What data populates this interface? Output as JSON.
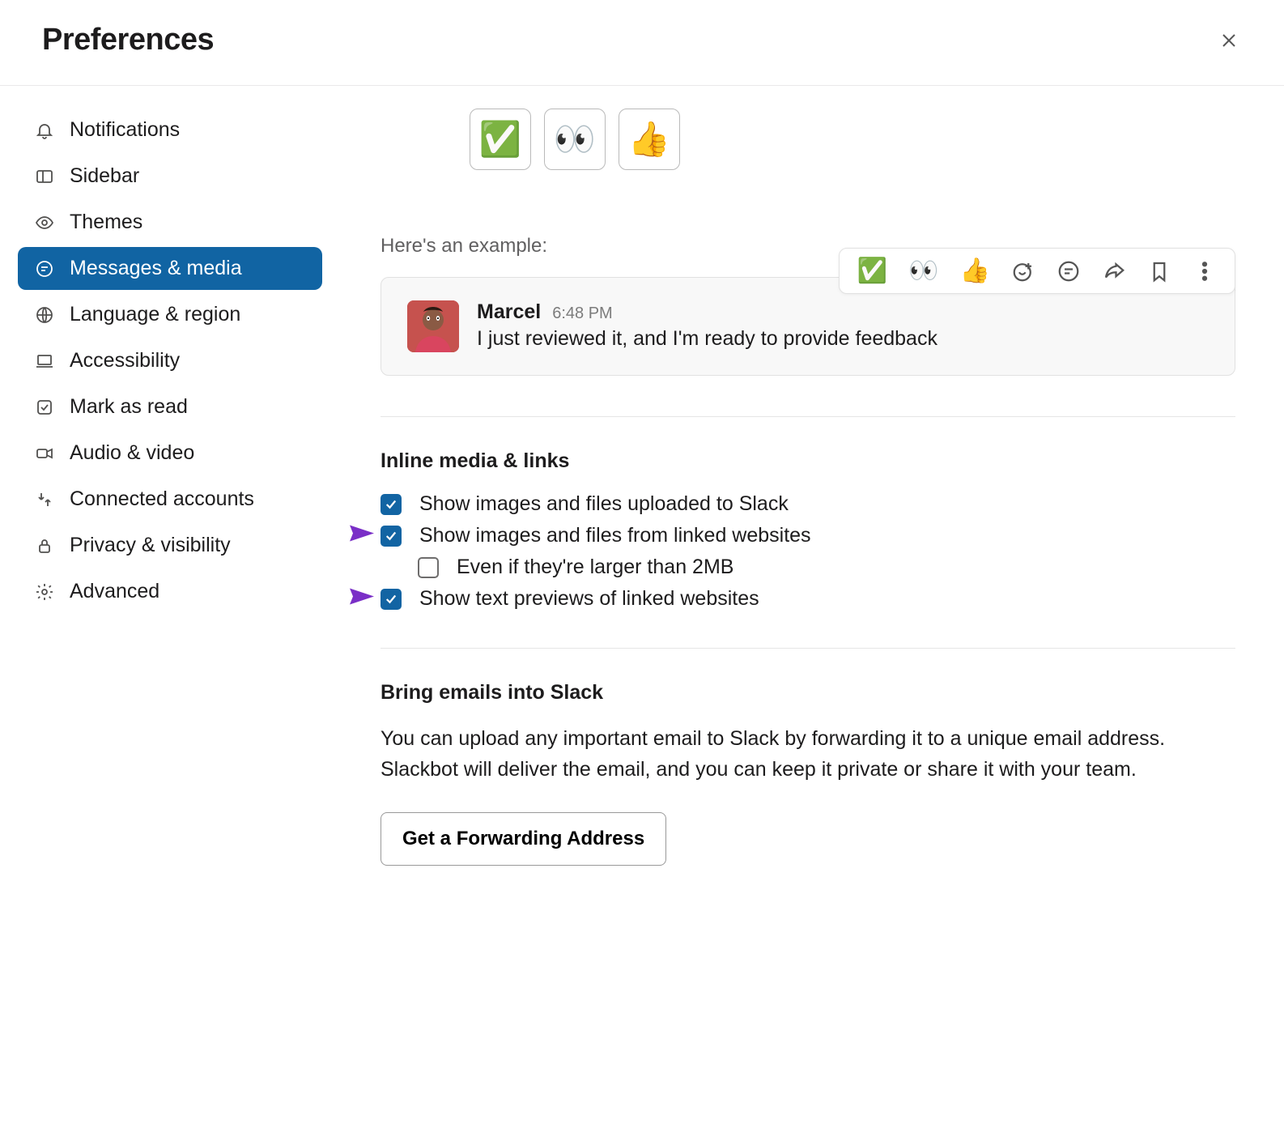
{
  "header": {
    "title": "Preferences"
  },
  "sidebar": {
    "items": [
      {
        "label": "Notifications"
      },
      {
        "label": "Sidebar"
      },
      {
        "label": "Themes"
      },
      {
        "label": "Messages & media"
      },
      {
        "label": "Language & region"
      },
      {
        "label": "Accessibility"
      },
      {
        "label": "Mark as read"
      },
      {
        "label": "Audio & video"
      },
      {
        "label": "Connected accounts"
      },
      {
        "label": "Privacy & visibility"
      },
      {
        "label": "Advanced"
      }
    ],
    "active_index": 3
  },
  "emoji_buttons": [
    "✅",
    "👀",
    "👍"
  ],
  "example": {
    "label": "Here's an example:",
    "name": "Marcel",
    "time": "6:48 PM",
    "text": "I just reviewed it, and I'm ready to provide feedback",
    "toolbar_emoji": [
      "✅",
      "👀",
      "👍"
    ]
  },
  "inline_media": {
    "heading": "Inline media & links",
    "options": [
      {
        "label": "Show images and files uploaded to Slack",
        "checked": true,
        "pointer": false,
        "indented": false
      },
      {
        "label": "Show images and files from linked websites",
        "checked": true,
        "pointer": true,
        "indented": false
      },
      {
        "label": "Even if they're larger than 2MB",
        "checked": false,
        "pointer": false,
        "indented": true
      },
      {
        "label": "Show text previews of linked websites",
        "checked": true,
        "pointer": true,
        "indented": false
      }
    ]
  },
  "emails": {
    "heading": "Bring emails into Slack",
    "body": "You can upload any important email to Slack by forwarding it to a unique email address. Slackbot will deliver the email, and you can keep it private or share it with your team.",
    "button": "Get a Forwarding Address"
  }
}
